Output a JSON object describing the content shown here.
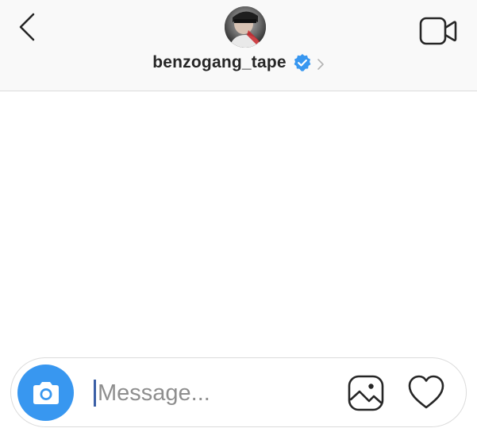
{
  "header": {
    "back_icon": "chevron-left-icon",
    "username": "benzogang_tape",
    "verified_icon": "verified-badge-icon",
    "verified_color": "#3897f0",
    "details_icon": "chevron-right-icon",
    "video_call_icon": "video-camera-icon"
  },
  "composer": {
    "camera_icon": "camera-icon",
    "camera_button_color": "#3897f0",
    "placeholder": "Message...",
    "gallery_icon": "image-gallery-icon",
    "like_icon": "heart-icon"
  }
}
